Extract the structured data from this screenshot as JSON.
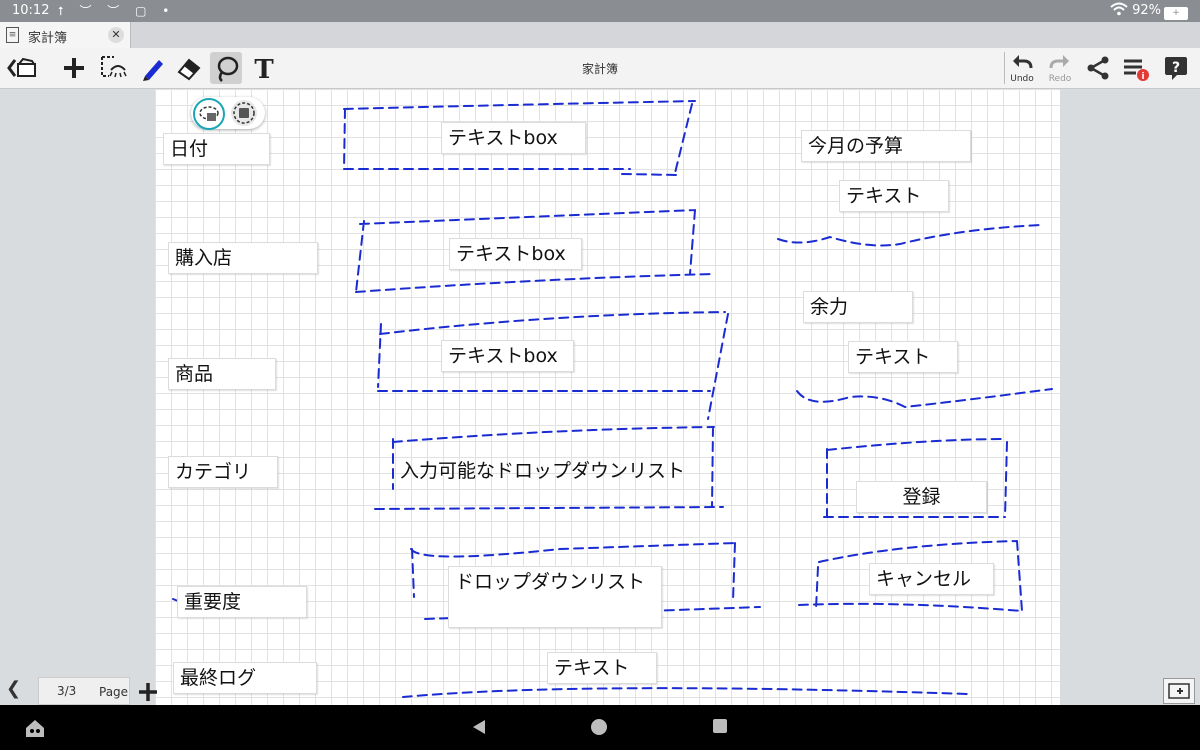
{
  "status_bar": {
    "time": "10:12",
    "battery": "92%"
  },
  "tab": {
    "title": "家計簿"
  },
  "toolbar": {
    "title": "家計簿",
    "undo_label": "Undo",
    "redo_label": "Redo"
  },
  "labels": {
    "date": "日付",
    "store": "購入店",
    "product": "商品",
    "category": "カテゴリ",
    "importance": "重要度",
    "last_log": "最終ログ",
    "textbox_1": "テキストbox",
    "textbox_2": "テキストbox",
    "textbox_3": "テキストbox",
    "dropdown_input": "入力可能なドロップダウンリスト",
    "dropdown": "ドロップダウンリスト",
    "log_text": "テキスト",
    "budget_label": "今月の予算",
    "budget_text": "テキスト",
    "remaining_label": "余力",
    "remaining_text": "テキスト",
    "register": "登録",
    "cancel": "キャンセル"
  },
  "page_nav": {
    "count": "3/3",
    "page_label": "Page"
  },
  "colors": {
    "ink": "#1a2bd1",
    "accent": "#19a7b8"
  }
}
